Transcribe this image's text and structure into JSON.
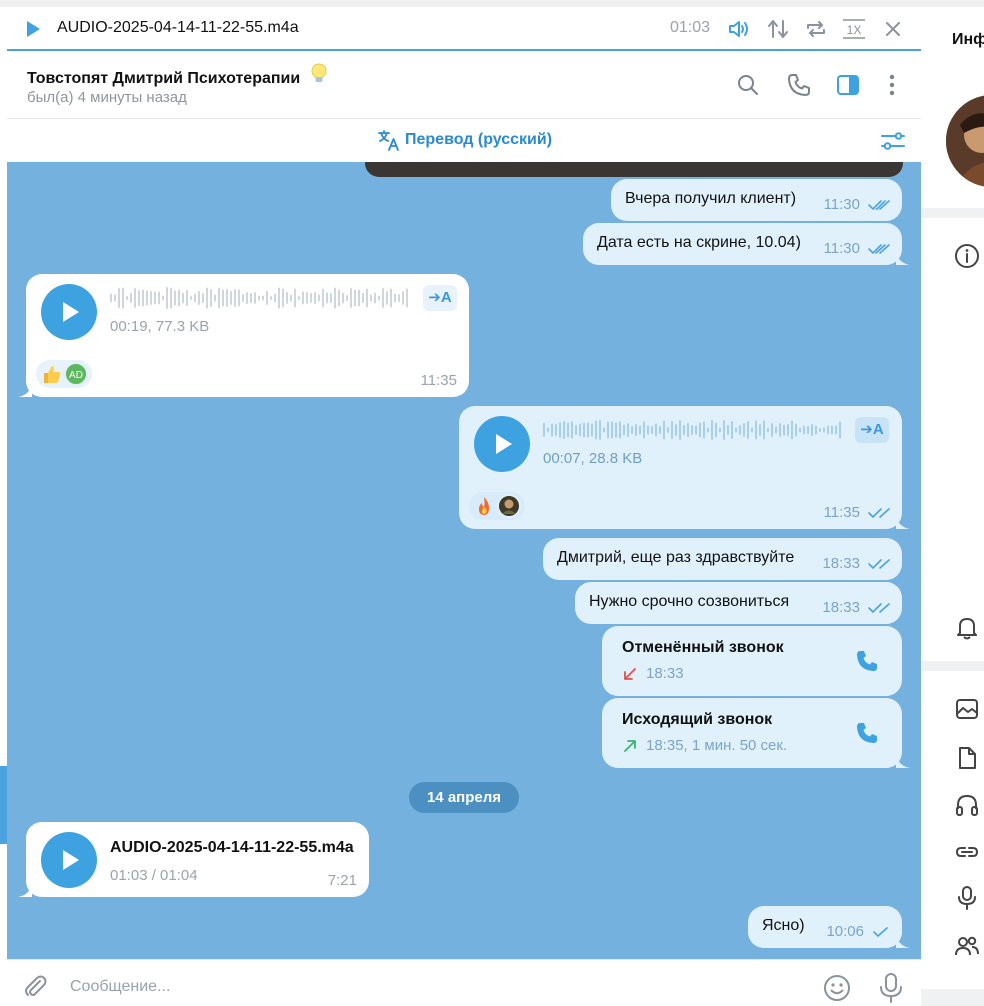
{
  "player": {
    "filename": "AUDIO-2025-04-14-11-22-55.m4a",
    "time": "01:03",
    "speed": "1X"
  },
  "chat_header": {
    "name": "Товстопят Дмитрий Психотерапии",
    "status": "был(а) 4 минуты назад"
  },
  "translate_bar": {
    "label": "Перевод (русский)"
  },
  "messages": [
    {
      "text": "Вчера получил клиент)",
      "time": "11:30"
    },
    {
      "text": "Дата есть на скрине, 10.04)",
      "time": "11:30"
    },
    {
      "type": "voice",
      "direction": "in",
      "info": "00:19, 77.3 KB",
      "time": "11:35",
      "translate": "➔A",
      "reaction_avatar": "AD"
    },
    {
      "type": "voice",
      "direction": "out",
      "info": "00:07, 28.8 KB",
      "time": "11:35",
      "translate": "➔A"
    },
    {
      "text": "Дмитрий, еще раз здравствуйте",
      "time": "18:33"
    },
    {
      "text": "Нужно срочно созвониться",
      "time": "18:33"
    },
    {
      "type": "call",
      "title": "Отменённый звонок",
      "detail": "18:33",
      "status_color": "#e0504b"
    },
    {
      "type": "call",
      "title": "Исходящий звонок",
      "detail": "18:35, 1 мин. 50 сек.",
      "status_color": "#3cb371"
    },
    {
      "text": "Ясно)",
      "time": "10:06"
    }
  ],
  "date_divider": "14 апреля",
  "audio_file": {
    "name": "AUDIO-2025-04-14-11-22-55.m4a",
    "progress": "01:03 / 01:04",
    "time": "7:21"
  },
  "composer": {
    "placeholder": "Сообщение..."
  },
  "right_panel": {
    "title": "Инф"
  },
  "colors": {
    "accent": "#3fa2e0",
    "chat_bg": "#74b1de",
    "out_bubble": "#e1f1fc",
    "in_bubble": "#ffffff"
  }
}
